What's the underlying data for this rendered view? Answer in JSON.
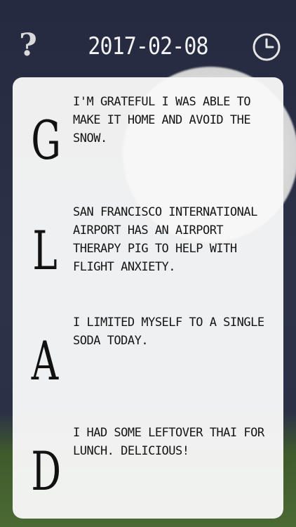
{
  "header": {
    "date": "2017-02-08",
    "help_icon": "question-icon",
    "history_icon": "clock-icon"
  },
  "entries": [
    {
      "letter": "G",
      "text": "I'm grateful I was able to make it home and avoid the snow."
    },
    {
      "letter": "L",
      "text": "San Francisco International Airport has an airport therapy pig to help with flight anxiety."
    },
    {
      "letter": "A",
      "text": "I limited myself to a single soda today."
    },
    {
      "letter": "D",
      "text": "I had some leftover Thai for lunch. Delicious!"
    }
  ],
  "colors": {
    "background": "#2a2f45",
    "card": "#f8f8f8",
    "text": "#151515",
    "header_text": "#f3f3f3"
  }
}
